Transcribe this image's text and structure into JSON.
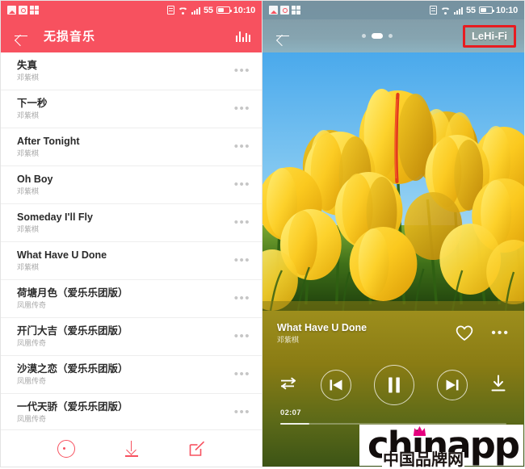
{
  "colors": {
    "accent_red": "#f7515f",
    "badge_outline_red": "#e81c20",
    "list_text": "#2a2a2a",
    "list_subtext": "#a8a8a8"
  },
  "status_bar": {
    "battery_percent": "55",
    "time": "10:10",
    "icons": [
      "image-icon",
      "message-icon",
      "apps-icon",
      "sim-icon",
      "wifi-icon",
      "signal-icon",
      "battery-icon"
    ]
  },
  "left_screen": {
    "app_bar": {
      "back_icon": "back-arrow-icon",
      "title": "无损音乐",
      "equalizer_icon": "equalizer-icon"
    },
    "songs": [
      {
        "title": "失真",
        "artist": "邓紫棋"
      },
      {
        "title": "下一秒",
        "artist": "邓紫棋"
      },
      {
        "title": "After Tonight",
        "artist": "邓紫棋"
      },
      {
        "title": "Oh Boy",
        "artist": "邓紫棋"
      },
      {
        "title": "Someday I'll Fly",
        "artist": "邓紫棋"
      },
      {
        "title": "What Have U Done",
        "artist": "邓紫棋"
      },
      {
        "title": "荷塘月色（爱乐乐团版）",
        "artist": "凤凰传奇"
      },
      {
        "title": "开门大吉（爱乐乐团版）",
        "artist": "凤凰传奇"
      },
      {
        "title": "沙漠之恋（爱乐乐团版）",
        "artist": "凤凰传奇"
      },
      {
        "title": "一代天骄（爱乐乐团版）",
        "artist": "凤凰传奇"
      }
    ],
    "row_more_label": "•••",
    "bottom_bar": {
      "play_all_icon": "play-circle-icon",
      "download_icon": "download-icon",
      "edit_icon": "edit-icon"
    }
  },
  "right_screen": {
    "app_bar": {
      "back_icon": "back-arrow-icon",
      "page_dots": [
        "inactive",
        "active",
        "inactive"
      ],
      "hifi_badge_label": "LeHi-Fi"
    },
    "artwork_alt": "yellow-tulips-photo",
    "now_playing": {
      "title": "What Have U Done",
      "artist": "邓紫棋",
      "favorite_icon": "heart-icon",
      "more_label": "•••"
    },
    "controls": {
      "shuffle_icon": "shuffle-icon",
      "previous_icon": "previous-track-icon",
      "play_pause_icon": "pause-icon",
      "next_icon": "next-track-icon",
      "download_icon": "download-icon"
    },
    "progress": {
      "current_time": "02:07",
      "percent": 13
    }
  },
  "watermark": {
    "main": "chinapp",
    "sub": "中国品牌网",
    "crown_icon": "crown-icon",
    "crown_color": "#e6007e"
  }
}
